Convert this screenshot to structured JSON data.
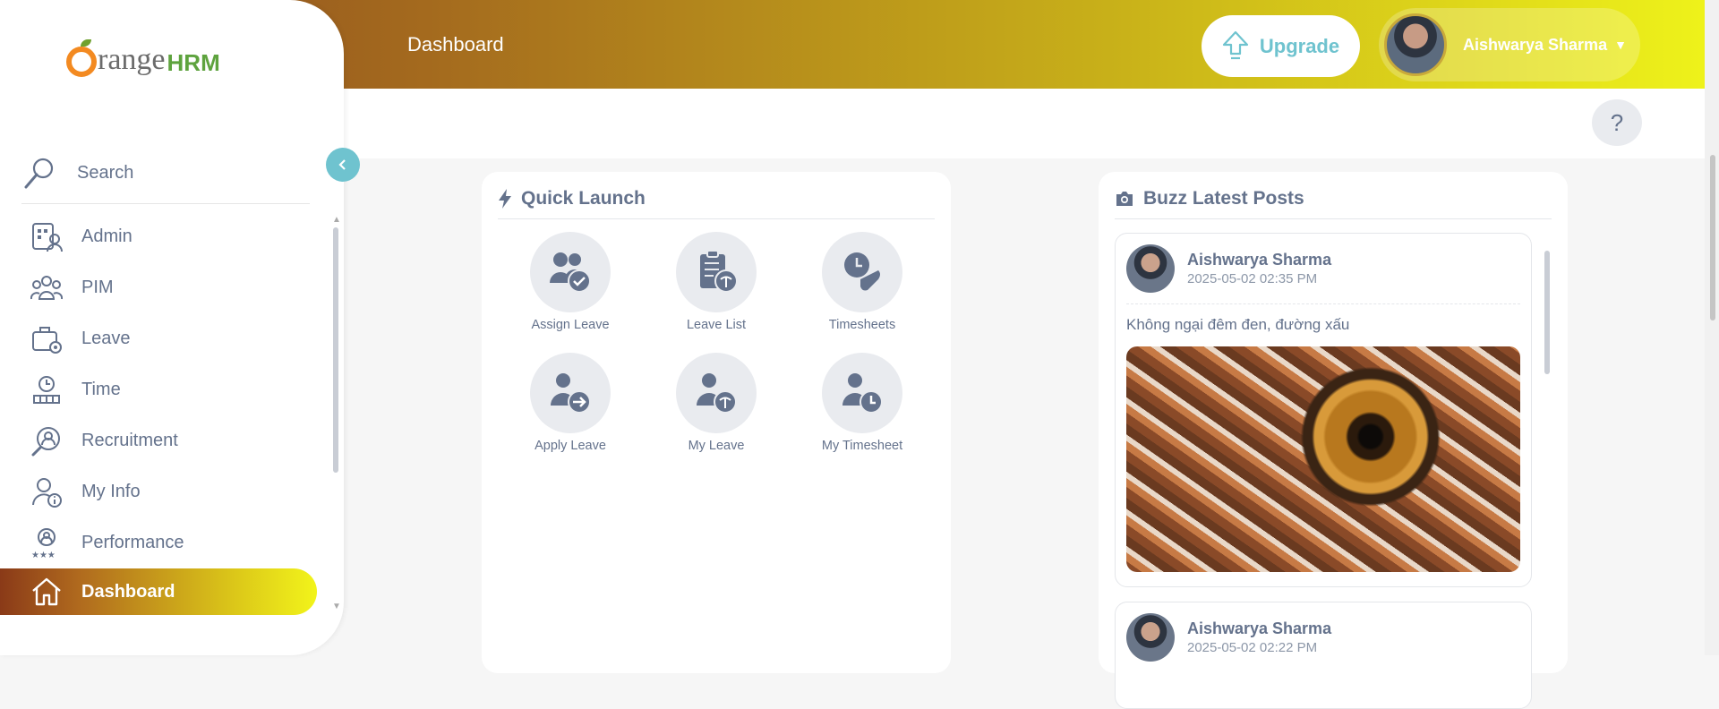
{
  "header": {
    "title": "Dashboard",
    "upgrade_label": "Upgrade",
    "user_name": "Aishwarya Sharma",
    "help_label": "?"
  },
  "brand": {
    "logo_main": "range",
    "logo_suffix": "HRM"
  },
  "sidebar": {
    "search_label": "Search",
    "items": [
      {
        "label": "Admin",
        "icon": "admin-icon"
      },
      {
        "label": "PIM",
        "icon": "pim-icon"
      },
      {
        "label": "Leave",
        "icon": "leave-icon"
      },
      {
        "label": "Time",
        "icon": "time-icon"
      },
      {
        "label": "Recruitment",
        "icon": "recruitment-icon"
      },
      {
        "label": "My Info",
        "icon": "my-info-icon"
      },
      {
        "label": "Performance",
        "icon": "performance-icon"
      },
      {
        "label": "Dashboard",
        "icon": "home-icon",
        "active": true
      }
    ]
  },
  "quick_launch": {
    "title": "Quick Launch",
    "items": [
      {
        "label": "Assign Leave",
        "icon": "assign-leave-icon"
      },
      {
        "label": "Leave List",
        "icon": "leave-list-icon"
      },
      {
        "label": "Timesheets",
        "icon": "timesheets-icon"
      },
      {
        "label": "Apply Leave",
        "icon": "apply-leave-icon"
      },
      {
        "label": "My Leave",
        "icon": "my-leave-icon"
      },
      {
        "label": "My Timesheet",
        "icon": "my-timesheet-icon"
      }
    ]
  },
  "buzz": {
    "title": "Buzz Latest Posts",
    "posts": [
      {
        "author": "Aishwarya Sharma",
        "time": "2025-05-02 02:35 PM",
        "text": "Không ngại đêm đen, đường xấu",
        "has_image": true
      },
      {
        "author": "Aishwarya Sharma",
        "time": "2025-05-02 02:22 PM"
      }
    ]
  },
  "colors": {
    "accent_teal": "#6fc3cf",
    "text_slate": "#64728c",
    "gradient_start": "#8a4a21",
    "gradient_end": "#eef21a",
    "logo_orange": "#f38a21",
    "logo_green": "#5ea33e"
  }
}
